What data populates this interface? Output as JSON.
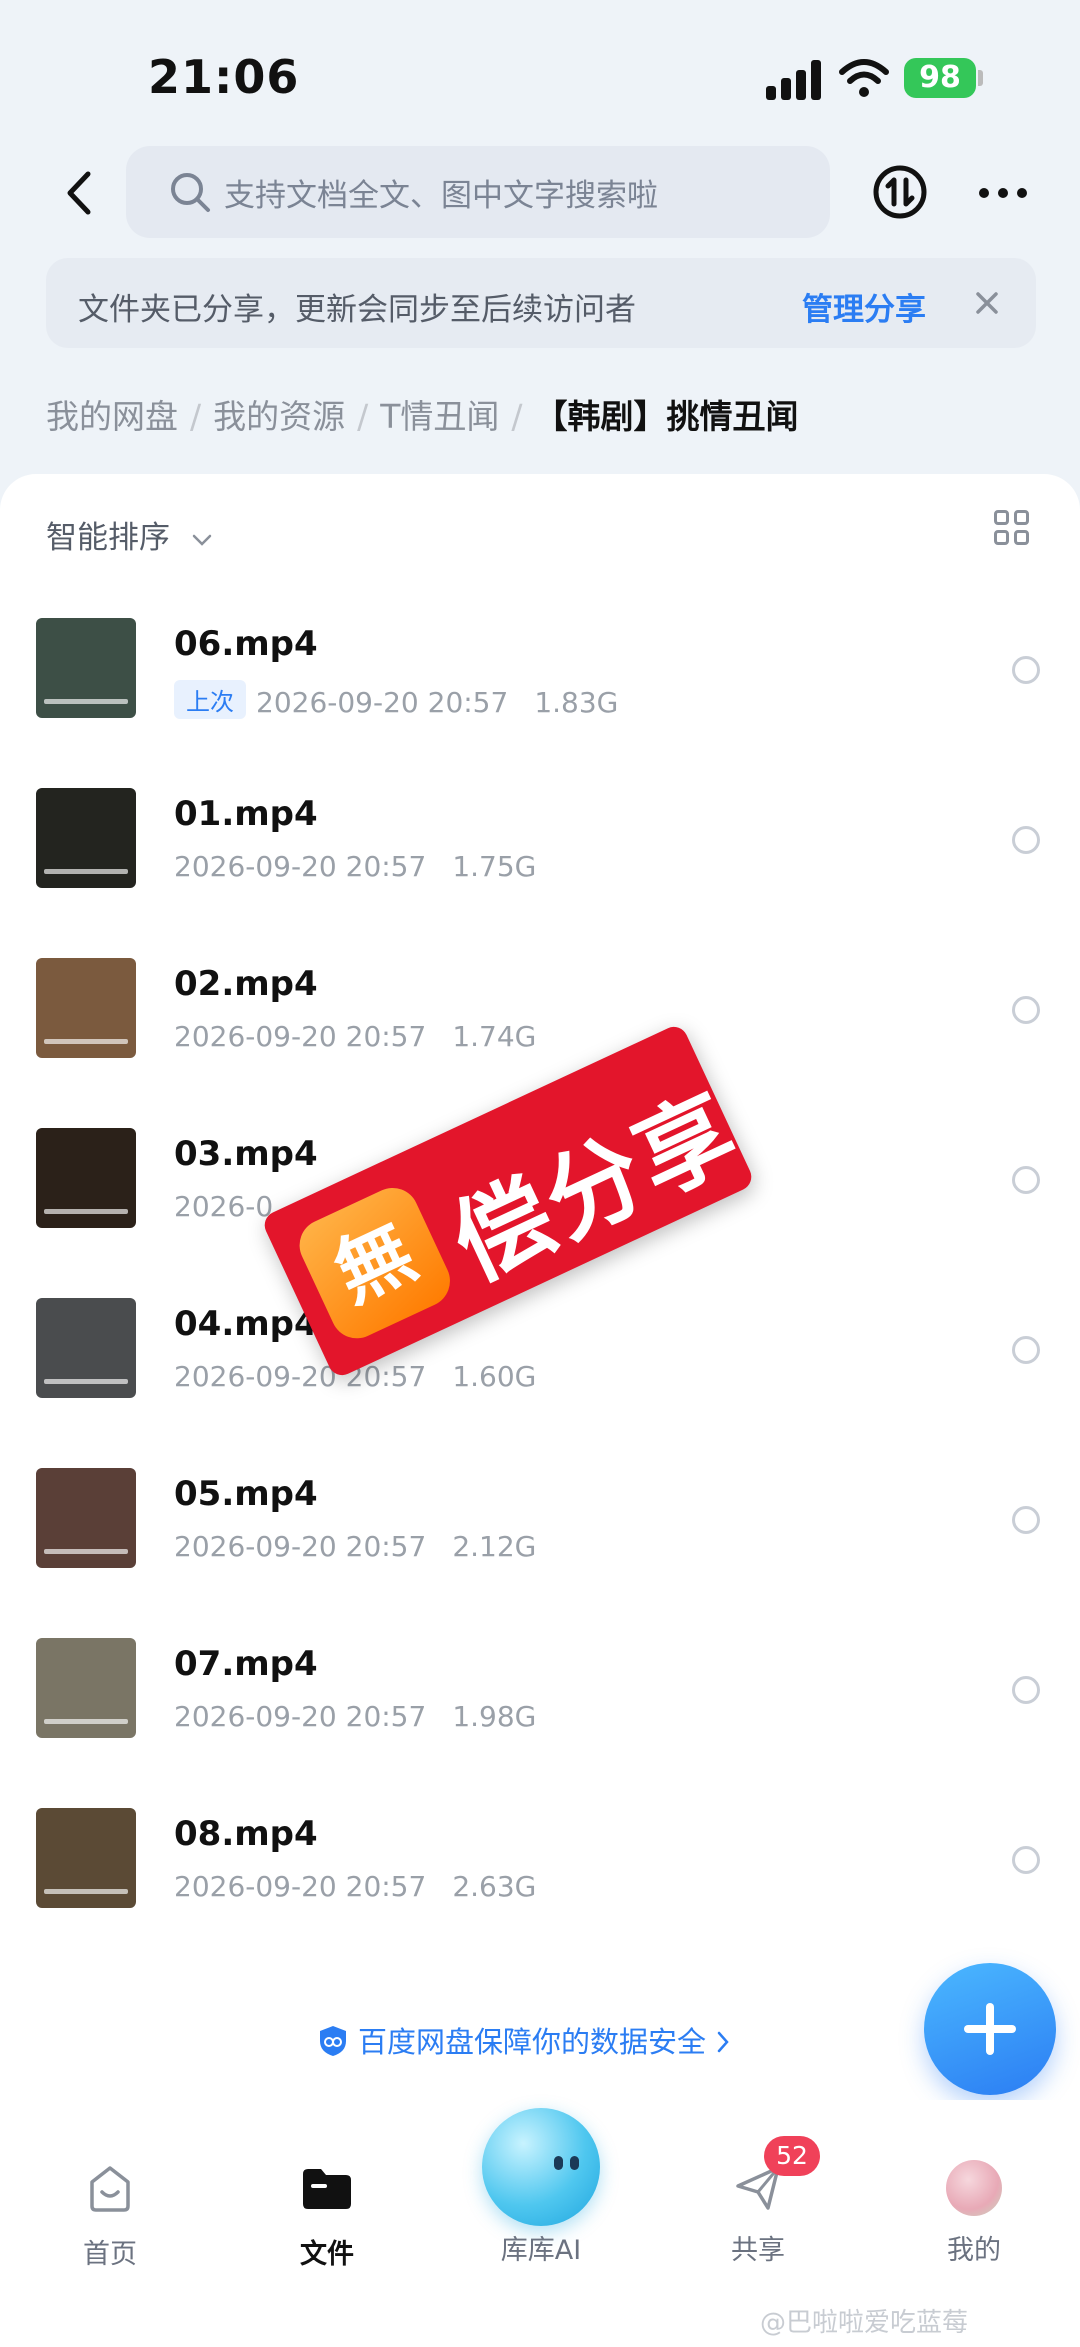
{
  "status_bar": {
    "time": "21:06",
    "battery": "98"
  },
  "top_nav": {
    "search_placeholder": "支持文档全文、图中文字搜索啦"
  },
  "notice": {
    "text": "文件夹已分享，更新会同步至后续访问者",
    "action": "管理分享"
  },
  "breadcrumb": [
    "我的网盘",
    "我的资源",
    "T情丑闻",
    "【韩剧】挑情丑闻"
  ],
  "sort": {
    "label": "智能排序"
  },
  "files": [
    {
      "name": "06.mp4",
      "tag": "上次",
      "date": "2026-09-20 20:57",
      "size": "1.83G",
      "thumb_color": "#3d4f46"
    },
    {
      "name": "01.mp4",
      "tag": "",
      "date": "2026-09-20 20:57",
      "size": "1.75G",
      "thumb_color": "#23241f"
    },
    {
      "name": "02.mp4",
      "tag": "",
      "date": "2026-09-20 20:57",
      "size": "1.74G",
      "thumb_color": "#7b5a3e"
    },
    {
      "name": "03.mp4",
      "tag": "",
      "date": "2026-0",
      "size": "",
      "thumb_color": "#2b2119"
    },
    {
      "name": "04.mp4",
      "tag": "",
      "date": "2026-09-20 20:57",
      "size": "1.60G",
      "thumb_color": "#4a4c4e"
    },
    {
      "name": "05.mp4",
      "tag": "",
      "date": "2026-09-20 20:57",
      "size": "2.12G",
      "thumb_color": "#5a3f37"
    },
    {
      "name": "07.mp4",
      "tag": "",
      "date": "2026-09-20 20:57",
      "size": "1.98G",
      "thumb_color": "#7a7565"
    },
    {
      "name": "08.mp4",
      "tag": "",
      "date": "2026-09-20 20:57",
      "size": "2.63G",
      "thumb_color": "#5b4a35"
    }
  ],
  "security_text": "百度网盘保障你的数据安全",
  "tabs": {
    "home": "首页",
    "files": "文件",
    "ai": "库库AI",
    "share": "共享",
    "share_badge": "52",
    "me": "我的"
  },
  "watermark": "@巴啦啦爱吃蓝莓",
  "promo": {
    "mark": "無",
    "text": "偿分享"
  },
  "colors": {
    "accent": "#2b7df3",
    "badge": "#f04159",
    "promo": "#e3152b"
  },
  "icons": [
    "back-icon",
    "search-icon",
    "transfer-icon",
    "more-icon",
    "close-icon",
    "chevron-down-icon",
    "grid-view-icon",
    "shield-icon",
    "chevron-right-icon",
    "plus-icon",
    "home-icon",
    "folder-icon",
    "share-plane-icon"
  ]
}
